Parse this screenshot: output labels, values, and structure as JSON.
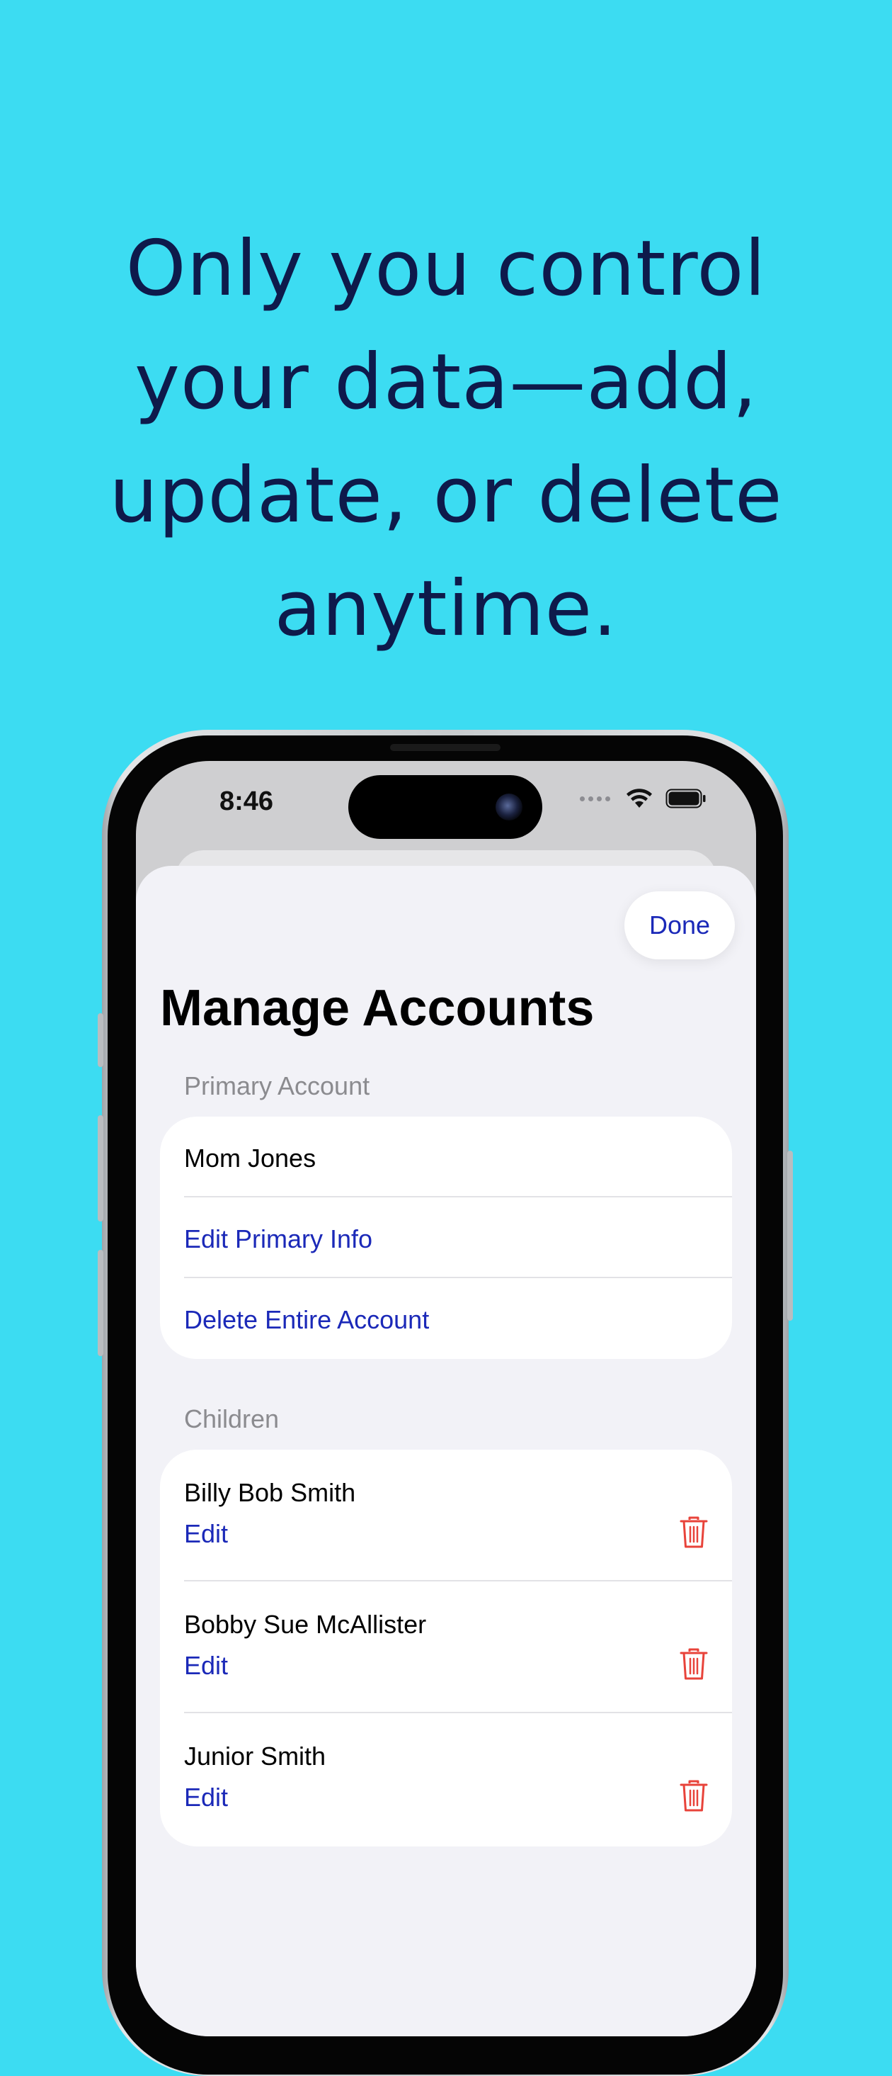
{
  "headline_lines": [
    "Only you control",
    "your data—add,",
    "update, or delete",
    "anytime."
  ],
  "status_bar": {
    "time": "8:46",
    "icons": [
      "cellular-signal-icon",
      "wifi-icon",
      "battery-icon"
    ]
  },
  "nav": {
    "done_label": "Done"
  },
  "page_title": "Manage Accounts",
  "primary_section": {
    "header": "Primary Account",
    "name": "Mom Jones",
    "edit_label": "Edit Primary Info",
    "delete_label": "Delete Entire Account"
  },
  "children_section": {
    "header": "Children",
    "items": [
      {
        "name": "Billy Bob Smith",
        "edit_label": "Edit"
      },
      {
        "name": "Bobby Sue McAllister",
        "edit_label": "Edit"
      },
      {
        "name": "Junior Smith",
        "edit_label": "Edit"
      }
    ]
  },
  "colors": {
    "background": "#3cdcf2",
    "headline": "#0e1a4b",
    "link": "#1b29b8",
    "destructive": "#e8433a"
  }
}
